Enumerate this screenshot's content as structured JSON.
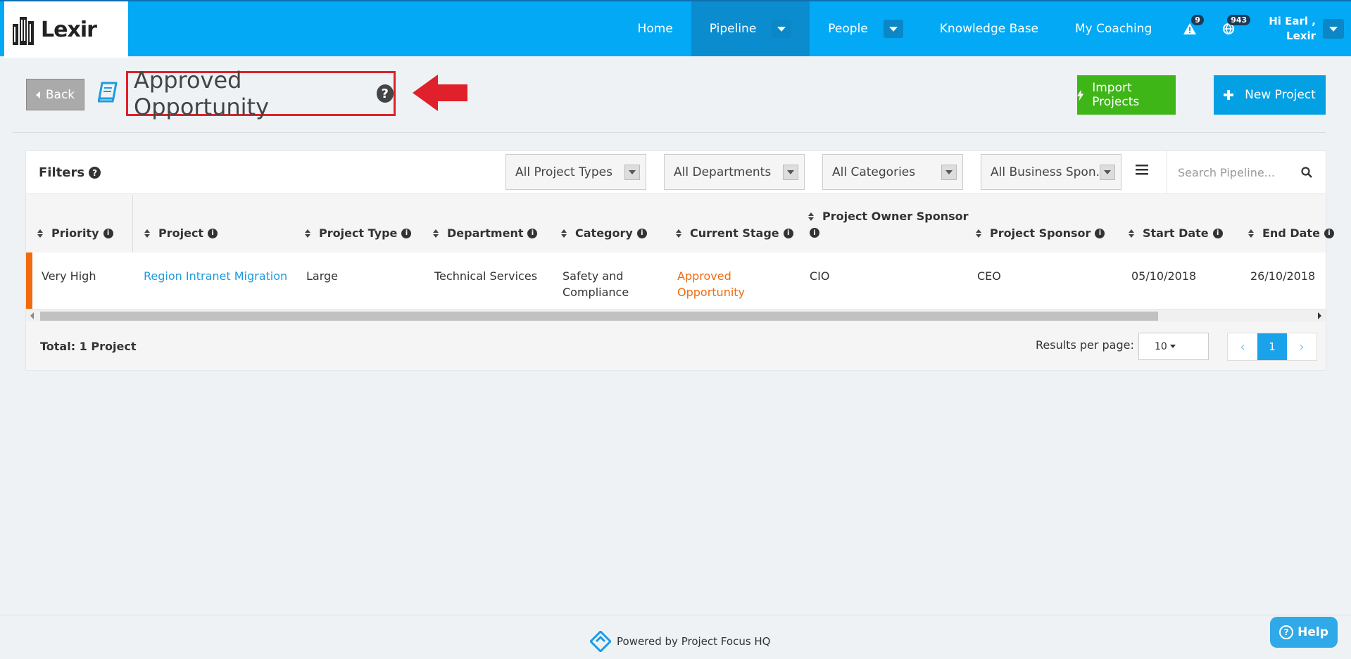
{
  "app": {
    "logo_text": "Lexir"
  },
  "nav": {
    "items": [
      {
        "label": "Home"
      },
      {
        "label": "Pipeline"
      },
      {
        "label": "People"
      },
      {
        "label": "Knowledge Base"
      },
      {
        "label": "My Coaching"
      }
    ],
    "alert_count": "9",
    "globe_count": "943",
    "user_greeting": "Hi Earl ,",
    "user_org": "Lexir"
  },
  "header": {
    "back_label": "Back",
    "title": "Approved Opportunity",
    "import_label": "Import Projects",
    "new_label": "New Project"
  },
  "filters": {
    "label": "Filters",
    "project_types": "All Project Types",
    "departments": "All Departments",
    "categories": "All Categories",
    "business_sponsors": "All Business Spon...",
    "search_placeholder": "Search Pipeline..."
  },
  "table": {
    "columns": {
      "priority": "Priority",
      "project": "Project",
      "project_type": "Project Type",
      "department": "Department",
      "category": "Category",
      "current_stage": "Current Stage",
      "owner_sponsor": "Project Owner Sponsor",
      "project_sponsor": "Project Sponsor",
      "start_date": "Start Date",
      "end_date": "End Date"
    },
    "rows": [
      {
        "priority": "Very High",
        "project": "Region Intranet Migration",
        "project_type": "Large",
        "department": "Technical Services",
        "category_line1": "Safety and",
        "category_line2": "Compliance",
        "stage_line1": "Approved",
        "stage_line2": "Opportunity",
        "owner_sponsor": "CIO",
        "project_sponsor": "CEO",
        "start_date": "05/10/2018",
        "end_date": "26/10/2018"
      }
    ]
  },
  "footer_bar": {
    "total": "Total: 1 Project",
    "results_label": "Results per page:",
    "results_value": "10",
    "current_page": "1"
  },
  "footer": {
    "powered": "Powered by Project Focus HQ",
    "help": "Help"
  },
  "colors": {
    "nav_blue": "#03a9f4",
    "import_green": "#3fb618",
    "priority_orange": "#f26a0e",
    "highlight_red": "#e0202a"
  }
}
